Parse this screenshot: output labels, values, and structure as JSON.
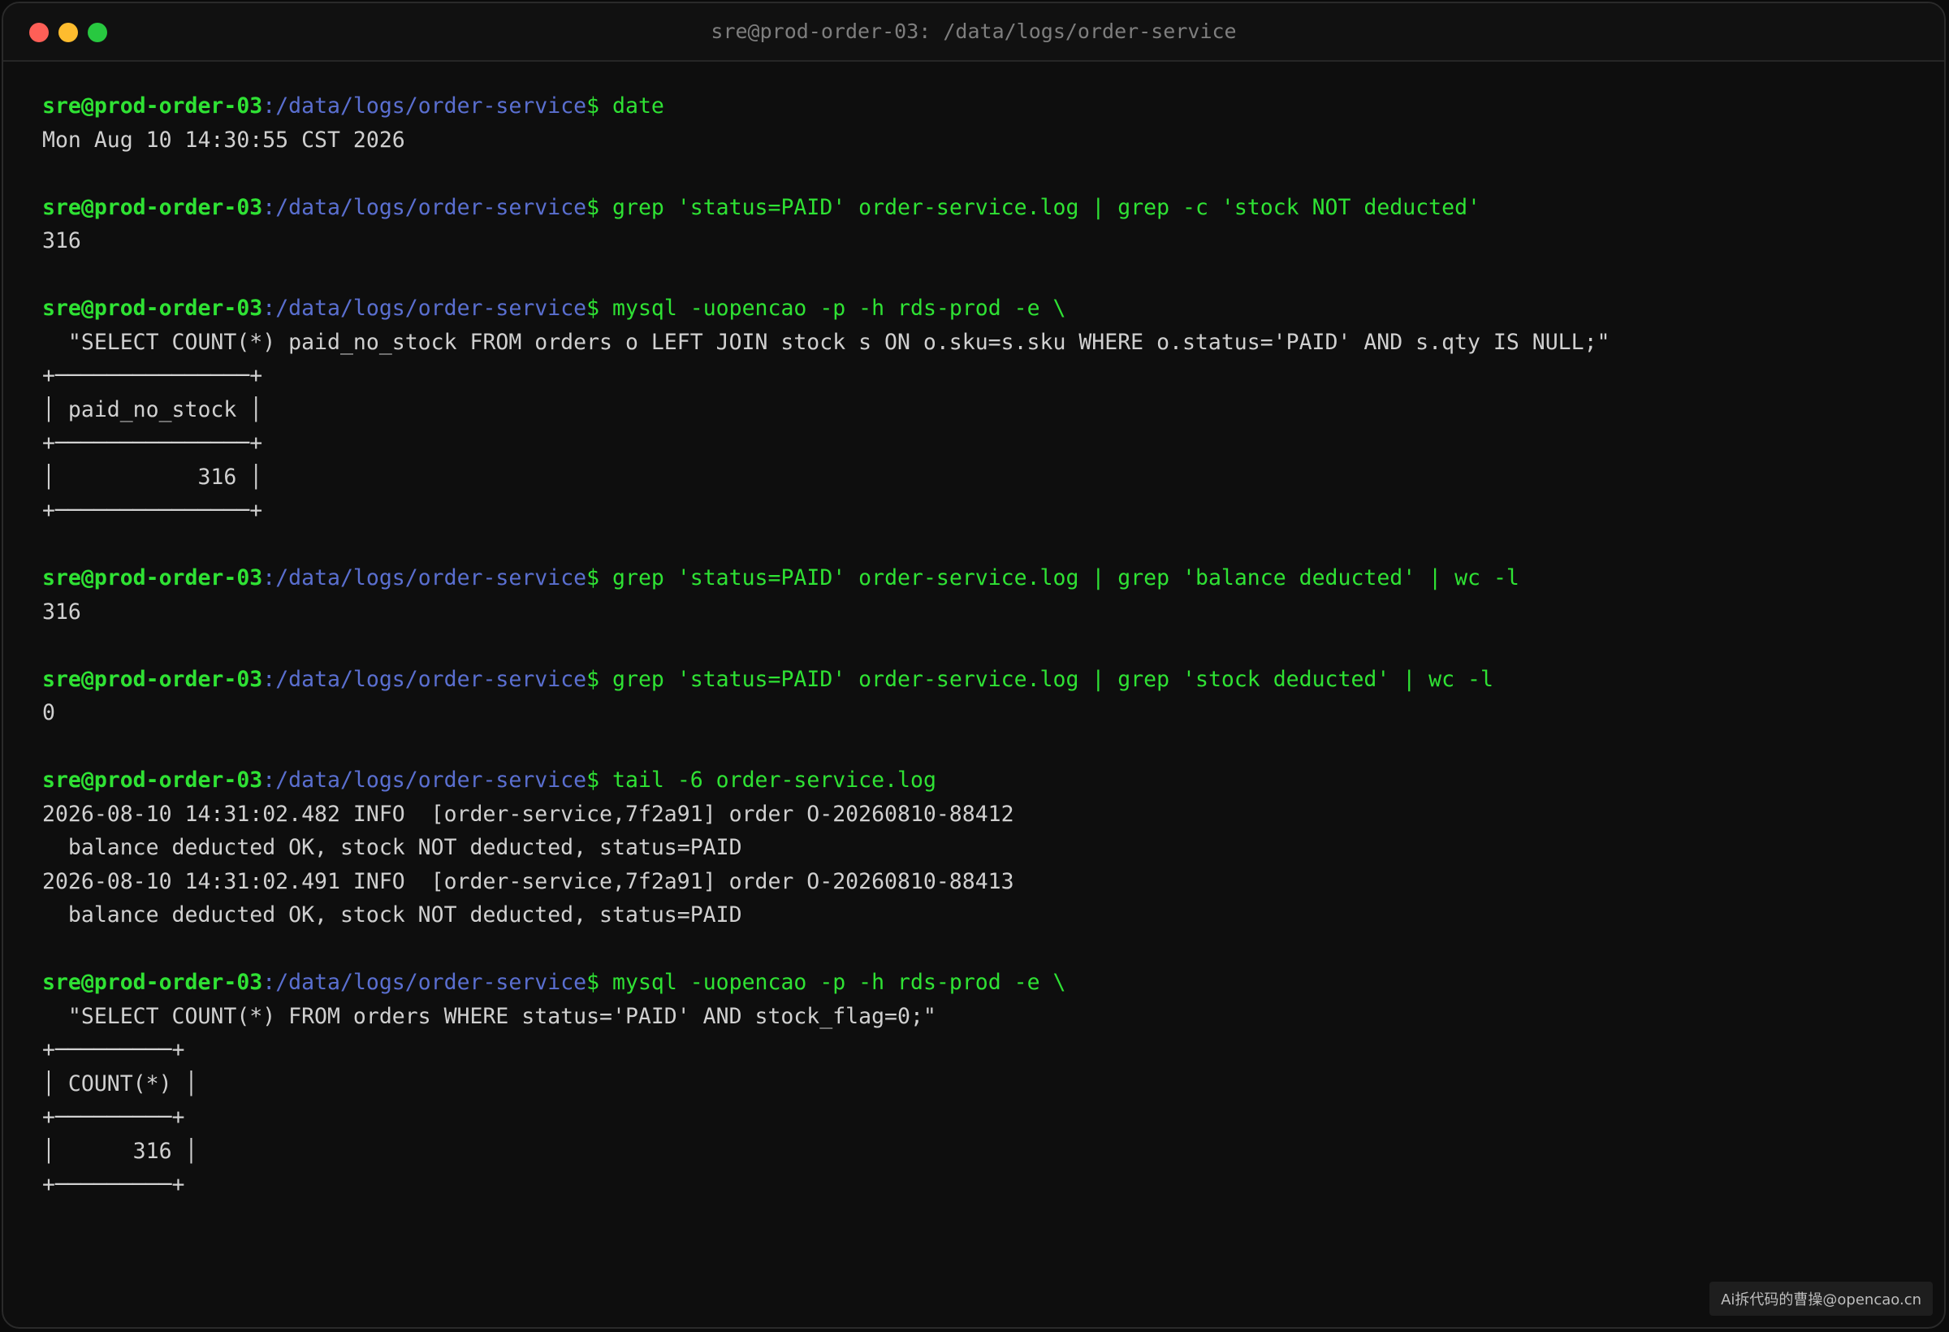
{
  "window": {
    "title": "sre@prod-order-03: /data/logs/order-service"
  },
  "prompt": {
    "user_host": "sre@prod-order-03",
    "colon": ":",
    "path": "/data/logs/order-service",
    "dollar": "$"
  },
  "blocks": [
    {
      "command": "date",
      "output": [
        "Mon Aug 10 14:30:55 CST 2026"
      ]
    },
    {
      "command": "grep 'status=PAID' order-service.log | grep -c 'stock NOT deducted'",
      "output": [
        "316"
      ]
    },
    {
      "command": "mysql -uopencao -p -h rds-prod -e \\",
      "output": [
        "  \"SELECT COUNT(*) paid_no_stock FROM orders o LEFT JOIN stock s ON o.sku=s.sku WHERE o.status='PAID' AND s.qty IS NULL;\"",
        "+───────────────+",
        "│ paid_no_stock │",
        "+───────────────+",
        "│           316 │",
        "+───────────────+"
      ]
    },
    {
      "command": "grep 'status=PAID' order-service.log | grep 'balance deducted' | wc -l",
      "output": [
        "316"
      ]
    },
    {
      "command": "grep 'status=PAID' order-service.log | grep 'stock deducted' | wc -l",
      "output": [
        "0"
      ]
    },
    {
      "command": "tail -6 order-service.log",
      "output": [
        "2026-08-10 14:31:02.482 INFO  [order-service,7f2a91] order O-20260810-88412",
        "  balance deducted OK, stock NOT deducted, status=PAID",
        "2026-08-10 14:31:02.491 INFO  [order-service,7f2a91] order O-20260810-88413",
        "  balance deducted OK, stock NOT deducted, status=PAID"
      ]
    },
    {
      "command": "mysql -uopencao -p -h rds-prod -e \\",
      "output": [
        "  \"SELECT COUNT(*) FROM orders WHERE status='PAID' AND stock_flag=0;\"",
        "+─────────+",
        "│ COUNT(*) │",
        "+─────────+",
        "│      316 │",
        "+─────────+"
      ]
    }
  ],
  "watermark": "Ai拆代码的曹操@opencao.cn"
}
